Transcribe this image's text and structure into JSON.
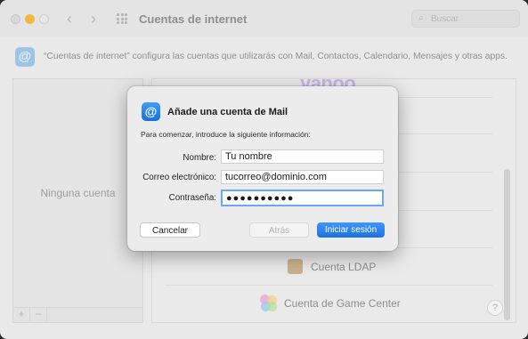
{
  "window": {
    "title": "Cuentas de internet"
  },
  "search": {
    "placeholder": "Buscar"
  },
  "header": {
    "description": "“Cuentas de internet” configura las cuentas que utilizarás con Mail, Contactos, Calendario, Mensajes y otras apps."
  },
  "accounts_list": {
    "empty_label": "Ninguna cuenta",
    "add_label": "+",
    "remove_label": "−"
  },
  "providers": {
    "items": [
      {
        "label": "yahoo."
      },
      {
        "label": "Cuenta LDAP"
      },
      {
        "label": "Cuenta de Game Center"
      }
    ]
  },
  "help": {
    "label": "?"
  },
  "dialog": {
    "title": "Añade una cuenta de Mail",
    "subtitle": "Para comenzar, introduce la siguiente información:",
    "name_label": "Nombre:",
    "name_value": "Tu nombre",
    "email_label": "Correo electrónico:",
    "email_value": "tucorreo@dominio.com",
    "password_label": "Contraseña:",
    "password_value": "●●●●●●●●●●",
    "cancel_label": "Cancelar",
    "back_label": "Atrás",
    "signin_label": "Iniciar sesión"
  },
  "colors": {
    "accent": "#1d71e0",
    "close": "#d8d8d8",
    "minimize": "#f4b73f"
  },
  "icons": {
    "mail": "at-icon",
    "search": "magnifier-icon"
  }
}
